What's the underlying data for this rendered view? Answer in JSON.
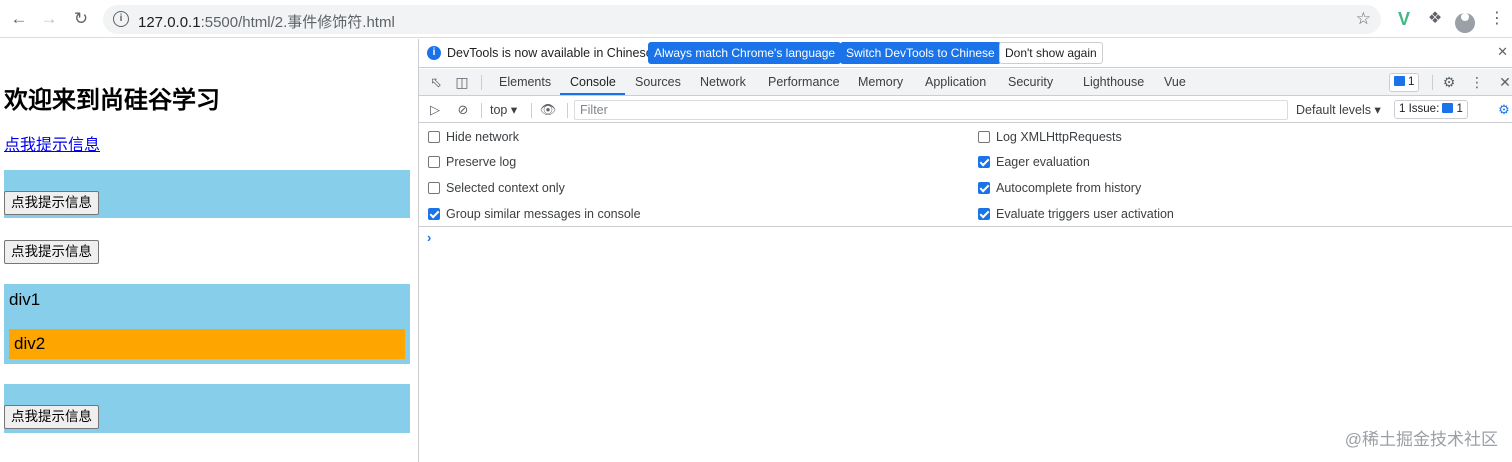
{
  "browser": {
    "url_host": "127.0.0.1",
    "url_rest": ":5500/html/2.事件修饰符.html"
  },
  "page": {
    "heading": "欢迎来到尚硅谷学习",
    "link_text": "点我提示信息",
    "button1": "点我提示信息",
    "button2": "点我提示信息",
    "div1_label": "div1",
    "div2_label": "div2",
    "button3": "点我提示信息"
  },
  "devtools": {
    "infobar": {
      "message": "DevTools is now available in Chinese!",
      "btn_match": "Always match Chrome's language",
      "btn_switch": "Switch DevTools to Chinese",
      "btn_dont_show": "Don't show again"
    },
    "tabs": [
      "Elements",
      "Console",
      "Sources",
      "Network",
      "Performance",
      "Memory",
      "Application",
      "Security",
      "Lighthouse",
      "Vue"
    ],
    "active_tab": "Console",
    "issues_count": "1",
    "console": {
      "context": "top",
      "filter_placeholder": "Filter",
      "levels": "Default levels",
      "issue_label": "1 Issue:",
      "issue_count": "1"
    },
    "settings_left": [
      {
        "label": "Hide network",
        "checked": false
      },
      {
        "label": "Preserve log",
        "checked": false
      },
      {
        "label": "Selected context only",
        "checked": false
      },
      {
        "label": "Group similar messages in console",
        "checked": true
      }
    ],
    "settings_right": [
      {
        "label": "Log XMLHttpRequests",
        "checked": false
      },
      {
        "label": "Eager evaluation",
        "checked": true
      },
      {
        "label": "Autocomplete from history",
        "checked": true
      },
      {
        "label": "Evaluate triggers user activation",
        "checked": true
      }
    ],
    "prompt": "›"
  },
  "watermark": "@稀土掘金技术社区",
  "colors": {
    "skyblue": "#87ceeb",
    "orange": "#ffa500",
    "accent": "#1a73e8"
  }
}
